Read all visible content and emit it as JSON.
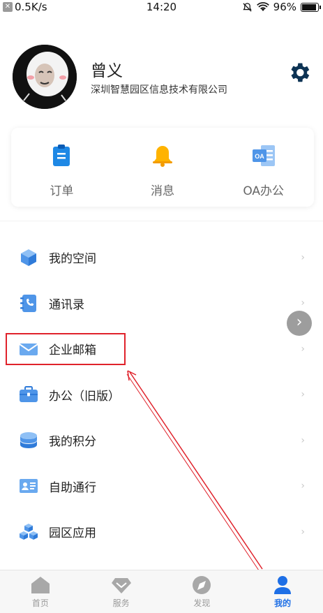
{
  "status_bar": {
    "network_speed": "0.5K/s",
    "time": "14:20",
    "battery": "96%",
    "battery_level": 0.96
  },
  "profile": {
    "name": "曾义",
    "company": "深圳智慧园区信息技术有限公司"
  },
  "quick_actions": [
    {
      "label": "订单",
      "icon": "clipboard-icon",
      "color": "#1e88e5"
    },
    {
      "label": "消息",
      "icon": "bell-icon",
      "color": "#ffb300"
    },
    {
      "label": "OA办公",
      "icon": "oa-icon",
      "color": "#64a6f0"
    }
  ],
  "menu": [
    {
      "label": "我的空间",
      "icon": "cube-icon"
    },
    {
      "label": "通讯录",
      "icon": "contacts-icon"
    },
    {
      "label": "企业邮箱",
      "icon": "mail-icon"
    },
    {
      "label": "办公（旧版）",
      "icon": "briefcase-icon"
    },
    {
      "label": "我的积分",
      "icon": "coins-icon"
    },
    {
      "label": "自助通行",
      "icon": "id-card-icon"
    },
    {
      "label": "园区应用",
      "icon": "boxes-icon"
    }
  ],
  "chevron": "›",
  "float_button": "›",
  "tabbar": [
    {
      "label": "首页",
      "icon": "home-icon"
    },
    {
      "label": "服务",
      "icon": "diamond-icon"
    },
    {
      "label": "发现",
      "icon": "compass-icon"
    },
    {
      "label": "我的",
      "icon": "person-icon",
      "active": true
    }
  ],
  "colors": {
    "accent_blue": "#1e6fe6",
    "icon_blue": "#64a6f0",
    "highlight_red": "#e0222b"
  }
}
